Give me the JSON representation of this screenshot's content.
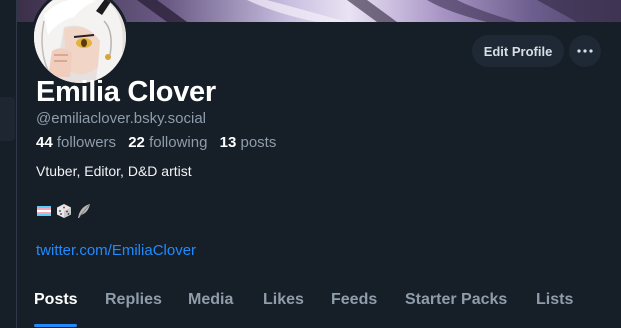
{
  "profile": {
    "display_name": "Emilia Clover",
    "handle": "@emiliaclover.bsky.social",
    "bio": "Vtuber, Editor, D&D artist",
    "link": "twitter.com/EmiliaClover",
    "emoji_icons": [
      "transgender-flag-icon",
      "game-die-icon",
      "feather-icon"
    ]
  },
  "stats": {
    "followers_count": "44",
    "followers_label": "followers",
    "following_count": "22",
    "following_label": "following",
    "posts_count": "13",
    "posts_label": "posts"
  },
  "actions": {
    "edit_label": "Edit Profile",
    "more_icon": "ellipsis-icon"
  },
  "tabs": [
    {
      "label": "Posts",
      "active": true
    },
    {
      "label": "Replies"
    },
    {
      "label": "Media"
    },
    {
      "label": "Likes"
    },
    {
      "label": "Feeds"
    },
    {
      "label": "Starter Packs"
    },
    {
      "label": "Lists"
    }
  ],
  "colors": {
    "background": "#161e27",
    "accent": "#208bfe",
    "muted_text": "#8f9cab",
    "button_bg": "#1e2935"
  }
}
